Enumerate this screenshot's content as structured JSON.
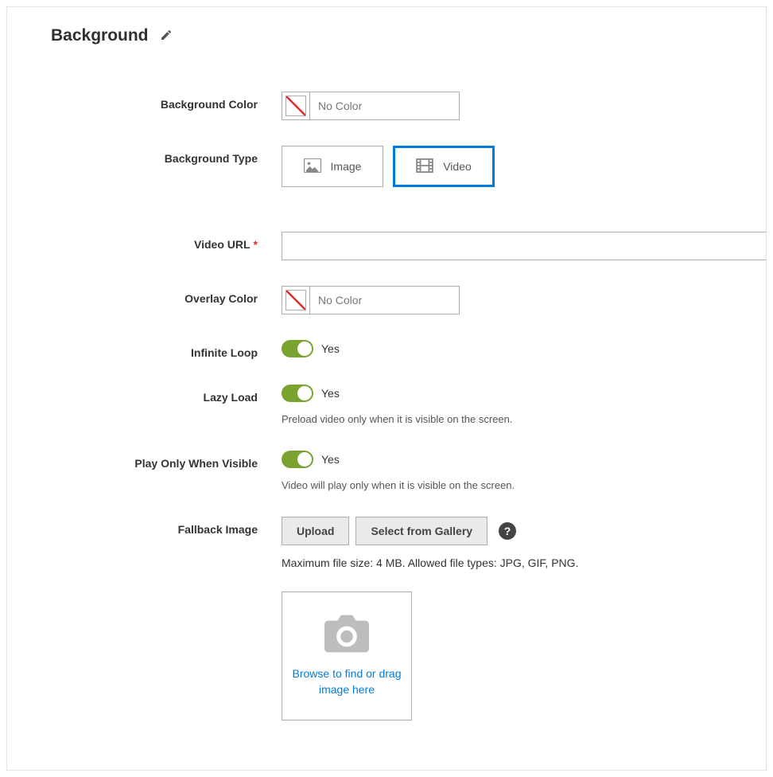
{
  "section": {
    "title": "Background"
  },
  "fields": {
    "bg_color": {
      "label": "Background Color",
      "placeholder": "No Color",
      "value": ""
    },
    "bg_type": {
      "label": "Background Type",
      "options": {
        "image": "Image",
        "video": "Video"
      },
      "selected": "video"
    },
    "video_url": {
      "label": "Video URL",
      "required": true,
      "value": ""
    },
    "overlay_color": {
      "label": "Overlay Color",
      "placeholder": "No Color",
      "value": ""
    },
    "infinite_loop": {
      "label": "Infinite Loop",
      "value_label": "Yes"
    },
    "lazy_load": {
      "label": "Lazy Load",
      "value_label": "Yes",
      "help": "Preload video only when it is visible on the screen."
    },
    "play_visible": {
      "label": "Play Only When Visible",
      "value_label": "Yes",
      "help": "Video will play only when it is visible on the screen."
    },
    "fallback": {
      "label": "Fallback Image",
      "upload_label": "Upload",
      "gallery_label": "Select from Gallery",
      "note": "Maximum file size: 4 MB. Allowed file types: JPG, GIF, PNG.",
      "dropzone": "Browse to find or drag image here"
    }
  },
  "icons": {
    "help_glyph": "?"
  }
}
